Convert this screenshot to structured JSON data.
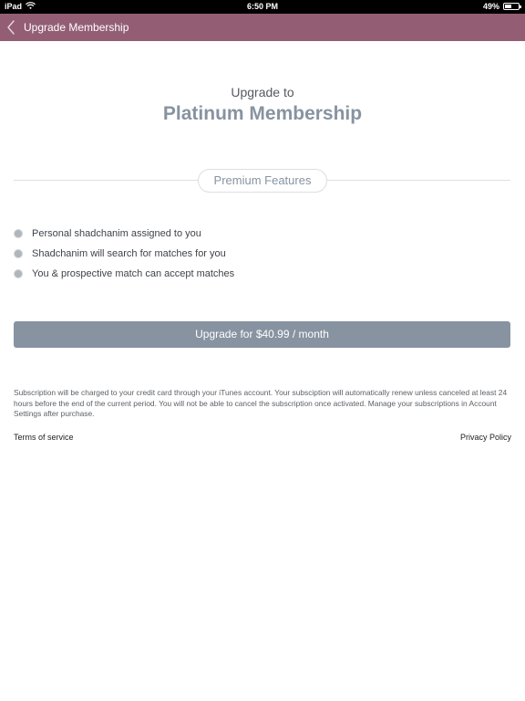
{
  "status_bar": {
    "device": "iPad",
    "time": "6:50 PM",
    "battery_percent": "49%",
    "battery_level": 0.49,
    "wifi_icon": "wifi-icon"
  },
  "nav": {
    "back_icon": "chevron-left-icon",
    "title": "Upgrade Membership",
    "accent_color": "#935e74"
  },
  "header": {
    "upgrade_to": "Upgrade to",
    "plan_name": "Platinum Membership"
  },
  "features": {
    "section_label": "Premium Features",
    "items": [
      {
        "label": "Personal shadchanim assigned to you"
      },
      {
        "label": "Shadchanim will search for matches for you"
      },
      {
        "label": "You & prospective match can accept matches"
      }
    ]
  },
  "cta": {
    "label": "Upgrade for $40.99 / month",
    "color": "#8793a1"
  },
  "disclaimer": "Subscription will be charged to your credit card through your iTunes account. Your subsciption will automatically renew unless canceled at least 24 hours before the end of the current period. You will not be able to cancel the subscription once activated. Manage your subscriptions in Account Settings after purchase.",
  "footer": {
    "terms_label": "Terms of service",
    "privacy_label": "Privacy Policy"
  }
}
